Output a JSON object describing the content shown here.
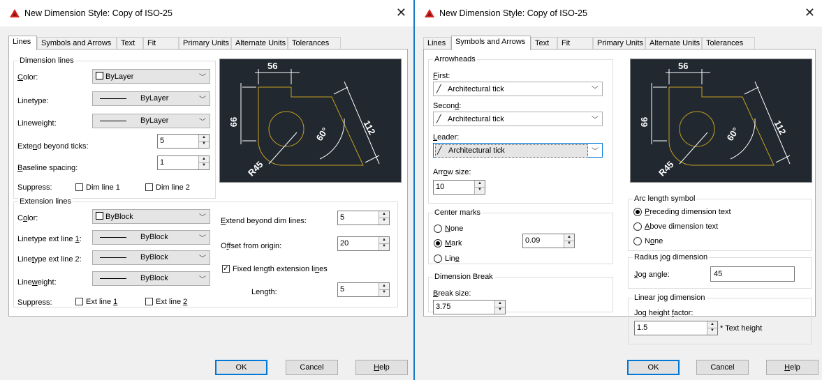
{
  "dialog_left": {
    "title": "New Dimension Style: Copy of ISO-25",
    "tabs": [
      "Lines",
      "Symbols and Arrows",
      "Text",
      "Fit",
      "Primary Units",
      "Alternate Units",
      "Tolerances"
    ],
    "active_tab": "Lines",
    "dimension_lines": {
      "legend": "Dimension lines",
      "color_label": "Color:",
      "color_value": "ByLayer",
      "linetype_label": "Linetype:",
      "linetype_value": "ByLayer",
      "lineweight_label": "Lineweight:",
      "lineweight_value": "ByLayer",
      "extend_label": "Extend beyond ticks:",
      "extend_value": "5",
      "baseline_label": "Baseline spacing:",
      "baseline_value": "1",
      "suppress_label": "Suppress:",
      "dim_line_1": "Dim line 1",
      "dim_line_2": "Dim line 2"
    },
    "extension_lines": {
      "legend": "Extension lines",
      "color_label": "Color:",
      "color_value": "ByBlock",
      "lt1_label": "Linetype ext line 1:",
      "lt1_value": "ByBlock",
      "lt2_label": "Linetype ext line 2:",
      "lt2_value": "ByBlock",
      "lineweight_label": "Lineweight:",
      "lineweight_value": "ByBlock",
      "suppress_label": "Suppress:",
      "ext_line_1": "Ext line 1",
      "ext_line_2": "Ext line 2",
      "extend_dim_label": "Extend beyond dim lines:",
      "extend_dim_value": "5",
      "offset_label": "Offset from origin:",
      "offset_value": "20",
      "fixed_label": "Fixed length extension lines",
      "fixed_checked": true,
      "length_label": "Length:",
      "length_value": "5"
    },
    "buttons": {
      "ok": "OK",
      "cancel": "Cancel",
      "help": "Help"
    }
  },
  "dialog_right": {
    "title": "New Dimension Style: Copy of ISO-25",
    "tabs": [
      "Lines",
      "Symbols and Arrows",
      "Text",
      "Fit",
      "Primary Units",
      "Alternate Units",
      "Tolerances"
    ],
    "active_tab": "Symbols and Arrows",
    "arrowheads": {
      "legend": "Arrowheads",
      "first_label": "First:",
      "first_value": "Architectural tick",
      "second_label": "Second:",
      "second_value": "Architectural tick",
      "leader_label": "Leader:",
      "leader_value": "Architectural tick",
      "arrow_size_label": "Arrow size:",
      "arrow_size_value": "10"
    },
    "center_marks": {
      "legend": "Center marks",
      "none": "None",
      "mark": "Mark",
      "line": "Line",
      "selected": "Mark",
      "value": "0.09"
    },
    "dimension_break": {
      "legend": "Dimension Break",
      "break_size_label": "Break size:",
      "break_size_value": "3.75"
    },
    "arc_length": {
      "legend": "Arc length symbol",
      "preceding": "Preceding dimension text",
      "above": "Above dimension text",
      "none": "None",
      "selected": "Preceding dimension text"
    },
    "radius_jog": {
      "legend": "Radius jog dimension",
      "jog_angle_label": "Jog angle:",
      "jog_angle_value": "45"
    },
    "linear_jog": {
      "legend": "Linear jog dimension",
      "height_factor_label": "Jog height factor:",
      "height_factor_value": "1.5",
      "suffix": "* Text height"
    },
    "buttons": {
      "ok": "OK",
      "cancel": "Cancel",
      "help": "Help"
    }
  },
  "preview": {
    "dim_top": "56",
    "dim_left": "66",
    "dim_diag": "112",
    "dim_angle": "60°",
    "dim_radius": "R45"
  },
  "colors": {
    "preview_bg": "#212830",
    "geometry": "#c8a020",
    "dimension": "#ffffff",
    "accent": "#0078d7",
    "autocad_red": "#d4211e"
  }
}
